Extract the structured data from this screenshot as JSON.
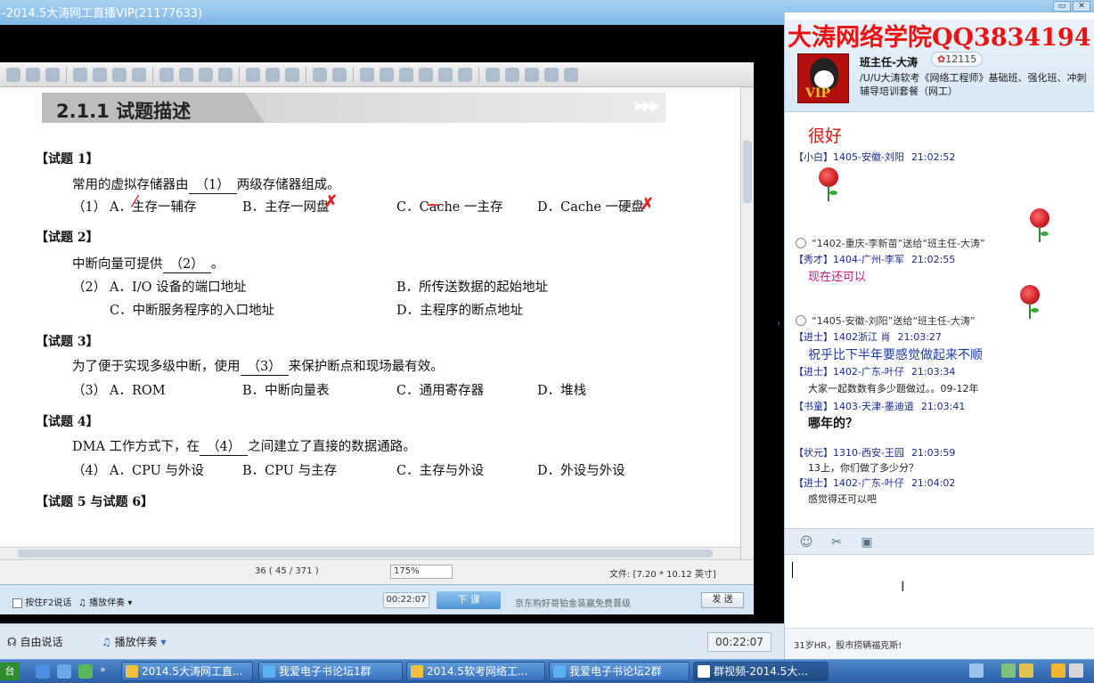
{
  "window": {
    "title": "-2014.5大涛网工直播VIP(21177633)"
  },
  "watermark": "大涛网络学院QQ3834194",
  "document": {
    "section_title": "2.1.1  试题描述",
    "banner_arrows": "▶▶▶",
    "questions": [
      {
        "head": "【试题 1】",
        "stem_before": "常用的虚拟存储器由",
        "blank": "（1）",
        "stem_after": "两级存储器组成。",
        "num": "（1）",
        "options": [
          "A．主存一辅存",
          "B．主存一网盘",
          "C．Cache 一主存",
          "D．Cache 一硬盘"
        ]
      },
      {
        "head": "【试题 2】",
        "stem_before": "中断向量可提供",
        "blank": "（2）",
        "stem_after": "。",
        "num": "（2）",
        "options": [
          "A．I/O 设备的端口地址",
          "B．所传送数据的起始地址",
          "C．中断服务程序的入口地址",
          "D．主程序的断点地址"
        ]
      },
      {
        "head": "【试题 3】",
        "stem_before": "为了便于实现多级中断，使用",
        "blank": "（3）",
        "stem_after": "来保护断点和现场最有效。",
        "num": "（3）",
        "options": [
          "A．ROM",
          "B．中断向量表",
          "C．通用寄存器",
          "D．堆栈"
        ]
      },
      {
        "head": "【试题 4】",
        "stem_before": "DMA 工作方式下，在",
        "blank": "（4）",
        "stem_after": "之间建立了直接的数据通路。",
        "num": "（4）",
        "options": [
          "A．CPU 与外设",
          "B．CPU 与主存",
          "C．主存与外设",
          "D．外设与外设"
        ]
      },
      {
        "head": "【试题 5 与试题 6】"
      }
    ],
    "status": {
      "page": "36 ( 45 / 371 )",
      "zoom": "175%",
      "file": "文件: [7.20 * 10.12 英寸]"
    }
  },
  "player_inner": {
    "free_talk": "按住F2说话",
    "accompany": "播放伴奏",
    "time": "00:22:07",
    "next_btn": "下 课",
    "ad": "京东购好哥铂金装赢免费晋级",
    "send_btn": "发 送"
  },
  "player": {
    "free_talk": "自由说话",
    "accompany": "播放伴奏",
    "time": "00:22:07"
  },
  "host": {
    "name": "班主任-大涛",
    "badge": "12115",
    "desc": "/U/U大涛软考《网络工程师》基础班、强化班、冲刺辅导培训套餐（网工）"
  },
  "chat": {
    "messages": [
      {
        "kind": "text",
        "text": "很好",
        "color": "#e01010"
      },
      {
        "kind": "user",
        "level": "【小白】",
        "name": "1405-安徽-刘阳",
        "time": "21:02:52"
      },
      {
        "kind": "gift",
        "text": "“1402-重庆-李新苗”送给“班主任-大涛”"
      },
      {
        "kind": "user",
        "level": "【秀才】",
        "name": "1404-广州-李军",
        "time": "21:02:55"
      },
      {
        "kind": "text",
        "text": "现在还可以",
        "color": "#c0158a"
      },
      {
        "kind": "gift",
        "text": "“1405-安徽-刘阳”送给“班主任-大涛”"
      },
      {
        "kind": "user",
        "level": "【进士】",
        "name": "1402浙江  肖",
        "time": "21:03:27"
      },
      {
        "kind": "text",
        "text": "祝乎比下半年要感觉做起来不顺",
        "color": "#1a3aa8"
      },
      {
        "kind": "user",
        "level": "【进士】",
        "name": "1402-广东-叶仔",
        "time": "21:03:34"
      },
      {
        "kind": "text",
        "text": "大家一起数数有多少题做过。。09-12年",
        "color": "#222"
      },
      {
        "kind": "user",
        "level": "【书童】",
        "name": "1403-天津-墨迪道",
        "time": "21:03:41"
      },
      {
        "kind": "text",
        "text": "哪年的？",
        "color": "#111"
      },
      {
        "kind": "user",
        "level": "【状元】",
        "name": "1310-西安-王园",
        "time": "21:03:59"
      },
      {
        "kind": "text",
        "text": "13上，你们做了多少分？",
        "color": "#222"
      },
      {
        "kind": "user",
        "level": "【进士】",
        "name": "1402-广东-叶仔",
        "time": "21:04:02"
      },
      {
        "kind": "text",
        "text": "感觉得还可以吧",
        "color": "#222"
      }
    ],
    "footer_ad": "31岁HR，股市捞辆福克斯!"
  },
  "taskbar": {
    "tasks": [
      "2014.5大涛网工直...",
      "我爱电子书论坛1群",
      "2014.5软考网络工...",
      "我爱电子书论坛2群",
      "群视频-2014.5大..."
    ]
  }
}
